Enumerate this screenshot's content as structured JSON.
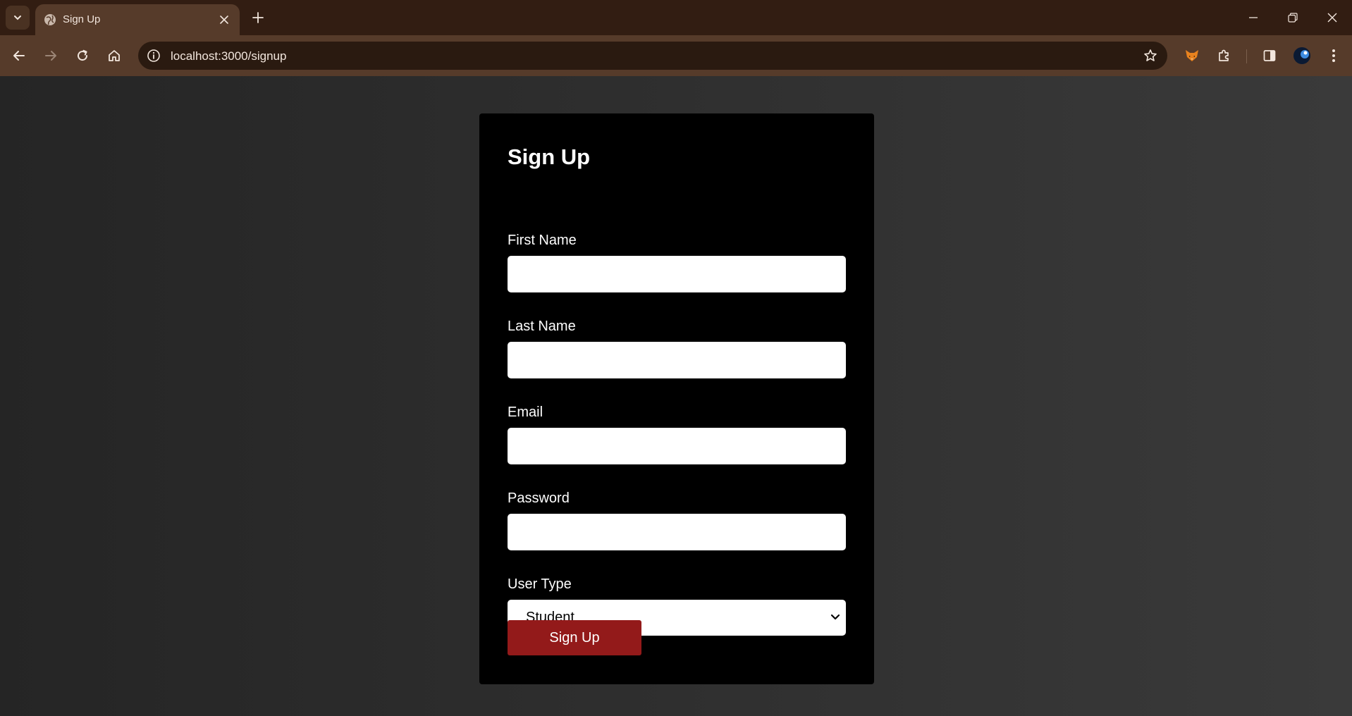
{
  "browser": {
    "tab": {
      "title": "Sign Up"
    },
    "address_bar": {
      "url": "localhost:3000/signup"
    }
  },
  "form": {
    "title": "Sign Up",
    "fields": [
      {
        "label": "First Name",
        "value": ""
      },
      {
        "label": "Last Name",
        "value": ""
      },
      {
        "label": "Email",
        "value": ""
      },
      {
        "label": "Password",
        "value": ""
      }
    ],
    "user_type": {
      "label": "User Type",
      "selected": "Student"
    },
    "submit_label": "Sign Up"
  },
  "colors": {
    "page_background": "#2a2a2a",
    "card_background": "#000000",
    "button_accent": "#931a1a",
    "browser_frame": "#563b2a"
  }
}
